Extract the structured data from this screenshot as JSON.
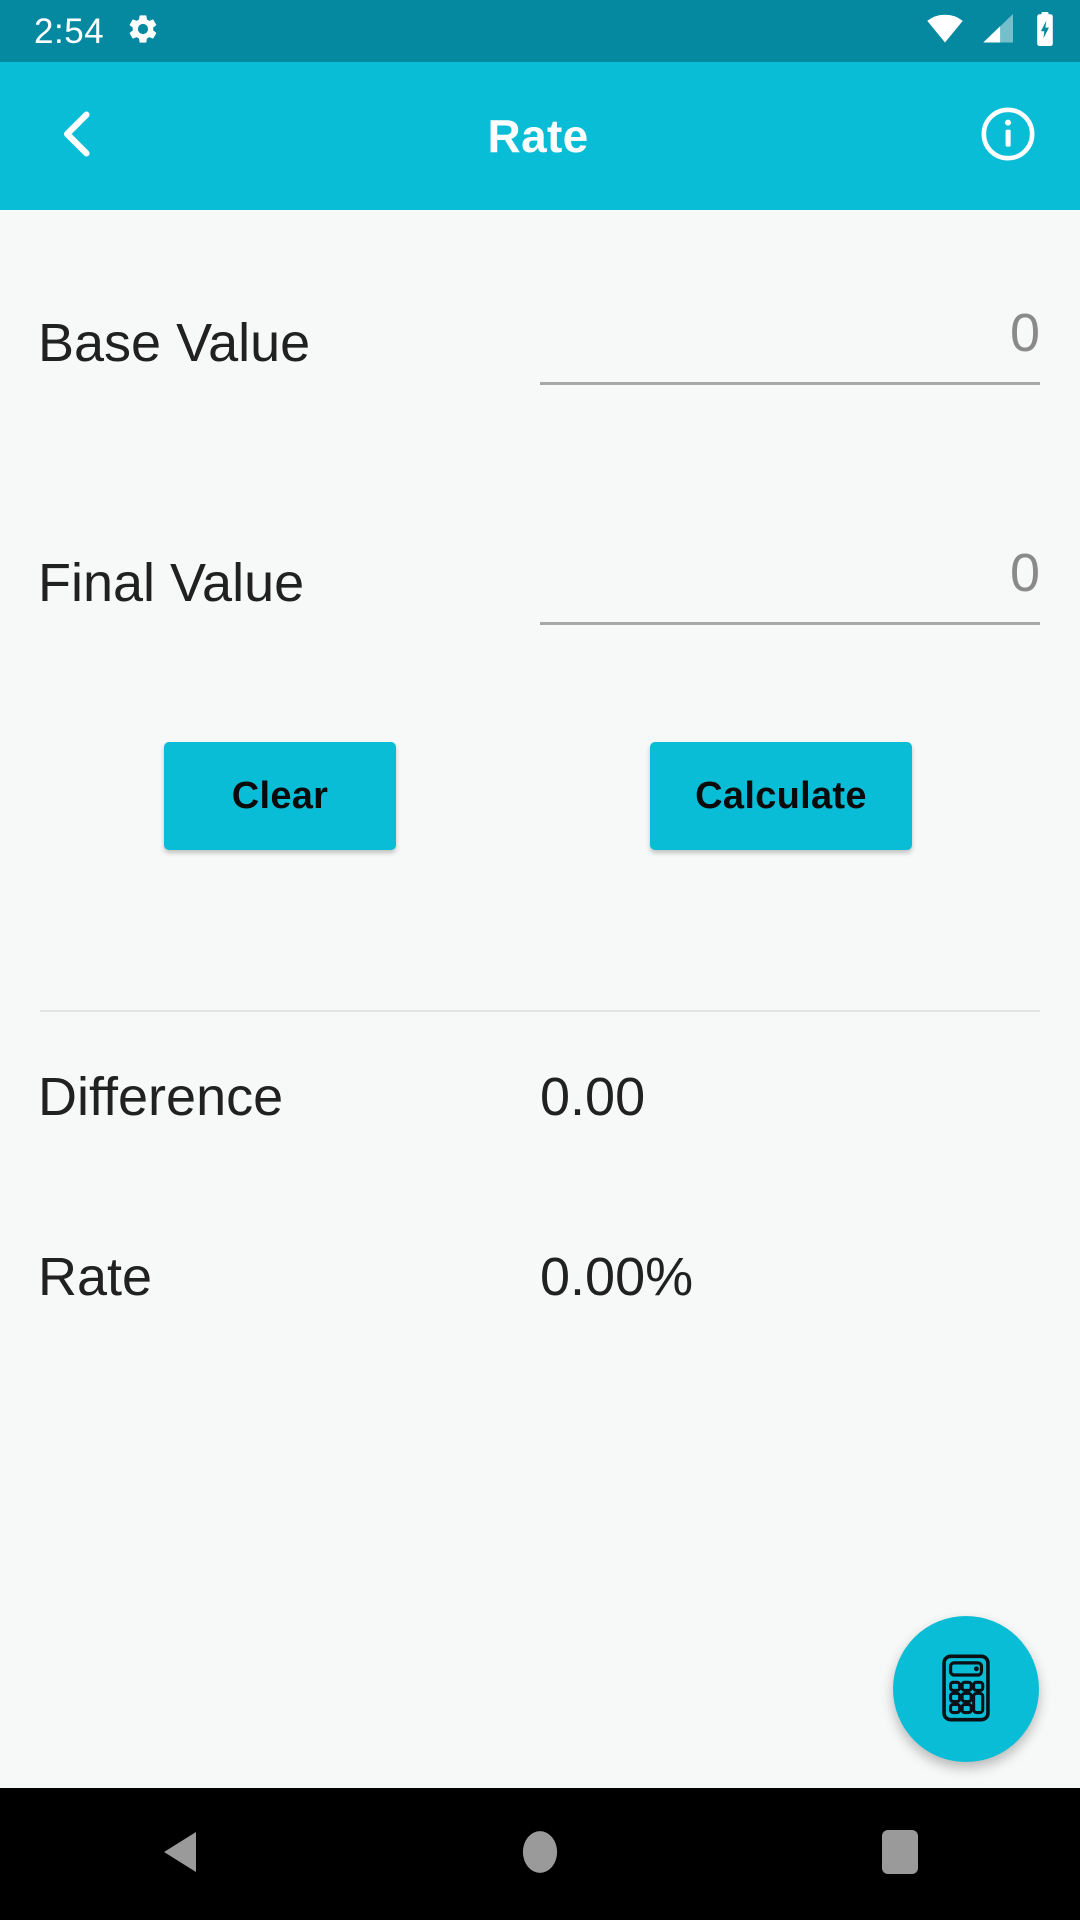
{
  "status_bar": {
    "time": "2:54",
    "background": "#0589a0",
    "icons": [
      "gear-icon",
      "wifi-icon",
      "cellular-signal-icon",
      "battery-charging-icon"
    ],
    "cellular_bars_filled": 2,
    "cellular_bars_total": 4
  },
  "app_bar": {
    "title": "Rate",
    "background": "#0abdd6",
    "back_icon": "chevron-left-icon",
    "info_icon": "info-circle-icon"
  },
  "fields": [
    {
      "label": "Base Value",
      "value": "",
      "placeholder": "0"
    },
    {
      "label": "Final Value",
      "value": "",
      "placeholder": "0"
    }
  ],
  "buttons": {
    "clear_label": "Clear",
    "calculate_label": "Calculate",
    "accent": "#0abdd6",
    "text_color": "#0a0a0a"
  },
  "results": [
    {
      "label": "Difference",
      "value": "0.00"
    },
    {
      "label": "Rate",
      "value": "0.00%"
    }
  ],
  "fab": {
    "icon": "calculator-icon",
    "background": "#0abdd6"
  },
  "nav_bar": {
    "background": "#000000",
    "items": [
      "back-triangle-icon",
      "home-circle-icon",
      "recents-square-icon"
    ]
  },
  "theme": {
    "page_background": "#f7f8f8",
    "label_color": "#212121",
    "placeholder_color": "#8a8a8a",
    "divider_color": "#e2e4e5",
    "input_underline_color": "#a8a8a8"
  }
}
